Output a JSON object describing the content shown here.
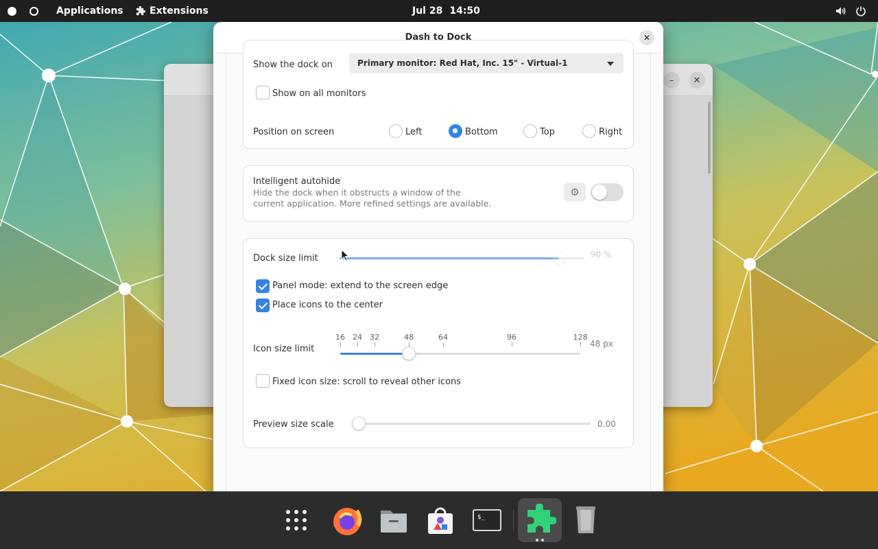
{
  "topbar": {
    "activities": "Applications",
    "extensions": "Extensions",
    "date": "Jul 28",
    "time": "14:50"
  },
  "dialog": {
    "title": "Dash to Dock"
  },
  "position": {
    "show_dock_on_label": "Show the dock on",
    "monitor_value": "Primary monitor: Red Hat, Inc. 15\" - Virtual-1",
    "all_monitors_label": "Show on all monitors",
    "all_monitors_checked": false,
    "position_label": "Position on screen",
    "options": [
      "Left",
      "Bottom",
      "Top",
      "Right"
    ],
    "selected": "Bottom"
  },
  "autohide": {
    "title": "Intelligent autohide",
    "description_line1": "Hide the dock when it obstructs a window of the",
    "description_line2": "current application. More refined settings are available.",
    "enabled": false
  },
  "size": {
    "dock_size_label": "Dock size limit",
    "dock_size_value": "90 %",
    "dock_size_fraction": 0.9,
    "panel_mode_label": "Panel mode: extend to the screen edge",
    "panel_mode_checked": true,
    "center_icons_label": "Place icons to the center",
    "center_icons_checked": true,
    "icon_size_label": "Icon size limit",
    "icon_size_value": "48 px",
    "icon_size_marks": [
      "16",
      "24",
      "32",
      "48",
      "64",
      "96",
      "128"
    ],
    "icon_size_current": 48,
    "fixed_icon_label": "Fixed icon size: scroll to reveal other icons",
    "fixed_icon_checked": false,
    "preview_label": "Preview size scale",
    "preview_value": "0.00"
  },
  "dock": {
    "items": [
      "app-grid-icon",
      "firefox-icon",
      "files-icon",
      "software-icon",
      "terminal-icon",
      "extensions-icon",
      "trash-icon"
    ],
    "active": "extensions-icon"
  },
  "colors": {
    "accent": "#3584e4",
    "topbar": "#1f1f1f",
    "dock": "#2c2c2c"
  }
}
